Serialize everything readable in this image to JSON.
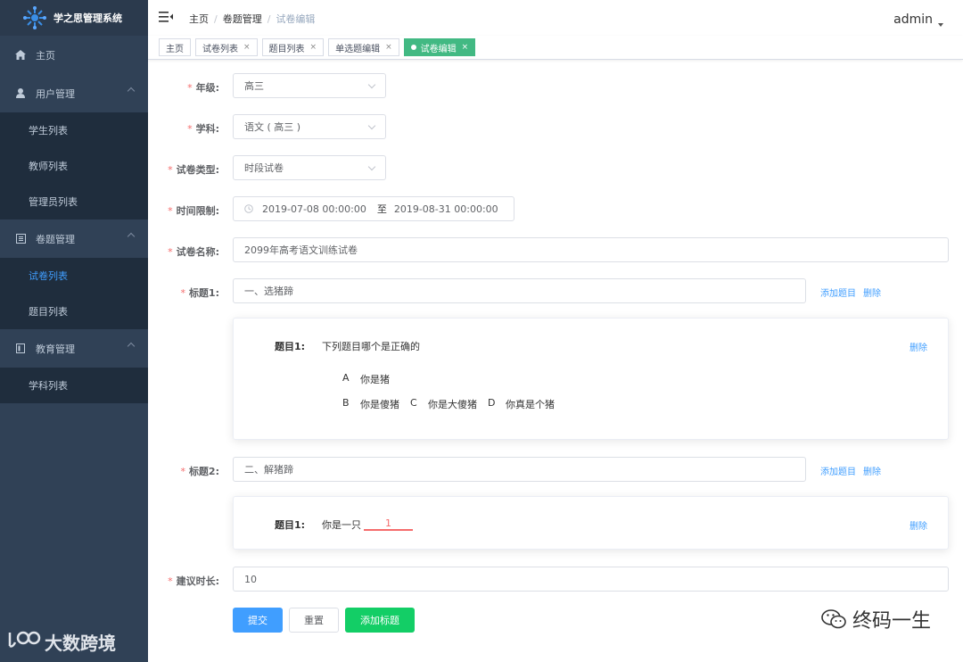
{
  "app": {
    "title": "学之思管理系统"
  },
  "sidebar": {
    "home": "主页",
    "user_mgmt": "用户管理",
    "user_items": [
      "学生列表",
      "教师列表",
      "管理员列表"
    ],
    "exam_mgmt": "卷题管理",
    "exam_items": [
      "试卷列表",
      "题目列表"
    ],
    "edu_mgmt": "教育管理",
    "edu_items": [
      "学科列表"
    ],
    "watermark": "大数跨境"
  },
  "header": {
    "breadcrumb": [
      "主页",
      "卷题管理",
      "试卷编辑"
    ],
    "user": "admin"
  },
  "tags": [
    "主页",
    "试卷列表",
    "题目列表",
    "单选题编辑",
    "试卷编辑"
  ],
  "form": {
    "grade_label": "年级:",
    "grade_value": "高三",
    "subject_label": "学科:",
    "subject_value": "语文 ( 高三 )",
    "paper_type_label": "试卷类型:",
    "paper_type_value": "时段试卷",
    "time_limit_label": "时间限制:",
    "time_start": "2019-07-08 00:00:00",
    "time_to": "至",
    "time_end": "2019-08-31 00:00:00",
    "paper_name_label": "试卷名称:",
    "paper_name_value": "2099年高考语文训练试卷",
    "title1_label": "标题1:",
    "title1_value": "一、选猪蹄",
    "title2_label": "标题2:",
    "title2_value": "二、解猪蹄",
    "add_question": "添加题目",
    "delete": "删除",
    "q1_label": "题目1:",
    "q1_text": "下列题目哪个是正确的",
    "q1_options": [
      {
        "key": "A",
        "text": "你是猪"
      },
      {
        "key": "B",
        "text": "你是傻猪"
      },
      {
        "key": "C",
        "text": "你是大傻猪"
      },
      {
        "key": "D",
        "text": "你真是个猪"
      }
    ],
    "q2_label": "题目1:",
    "q2_text": "你是一只",
    "q2_blank": "1",
    "duration_label": "建议时长:",
    "duration_value": "10",
    "submit": "提交",
    "reset": "重置",
    "add_title": "添加标题"
  },
  "watermark_right": "终码一生",
  "colors": {
    "sidebar_bg": "#304156",
    "primary": "#409eff",
    "success": "#13ce66",
    "tag_active": "#42b983",
    "required": "#f56c6c"
  }
}
